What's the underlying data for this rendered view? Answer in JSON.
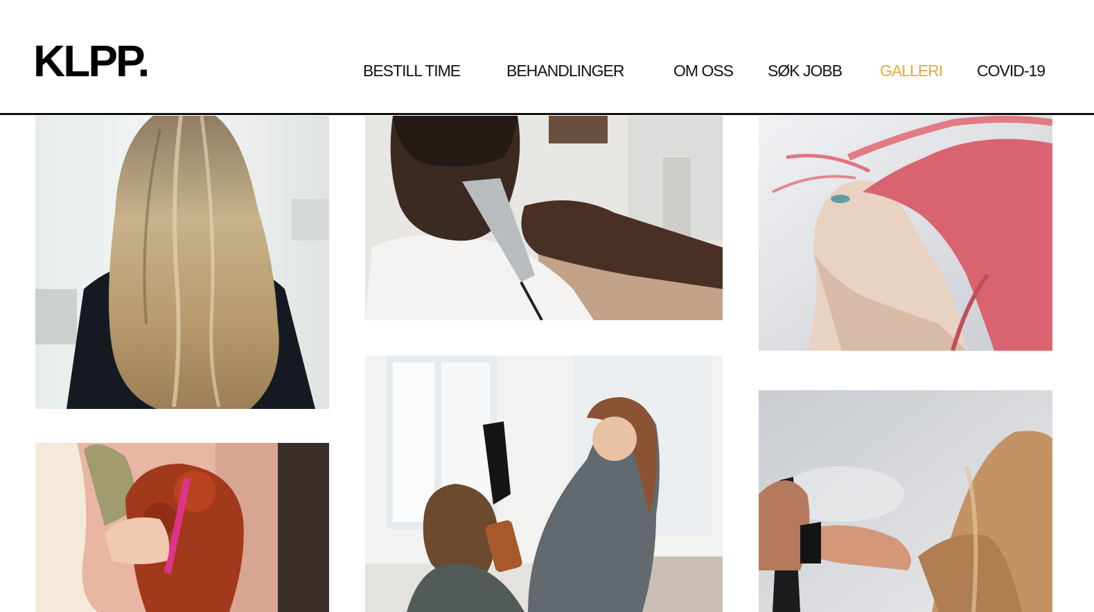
{
  "brand": {
    "logo_text": "KLPP."
  },
  "nav": {
    "items": [
      {
        "label": "BESTILL TIME"
      },
      {
        "label": "BEHANDLINGER"
      },
      {
        "label": "OM OSS"
      },
      {
        "label": "SØK JOBB"
      },
      {
        "label": "GALLERI",
        "active": true
      },
      {
        "label": "COVID-19"
      }
    ]
  },
  "colors": {
    "accent": "#e8a93a",
    "text": "#111111",
    "background": "#ffffff"
  },
  "gallery": {
    "photos": [
      {
        "name": "blonde-long-hair"
      },
      {
        "name": "barber-clipper"
      },
      {
        "name": "pink-hair-flip"
      },
      {
        "name": "red-updo"
      },
      {
        "name": "blow-dryer-salon"
      },
      {
        "name": "hairspray"
      }
    ]
  }
}
